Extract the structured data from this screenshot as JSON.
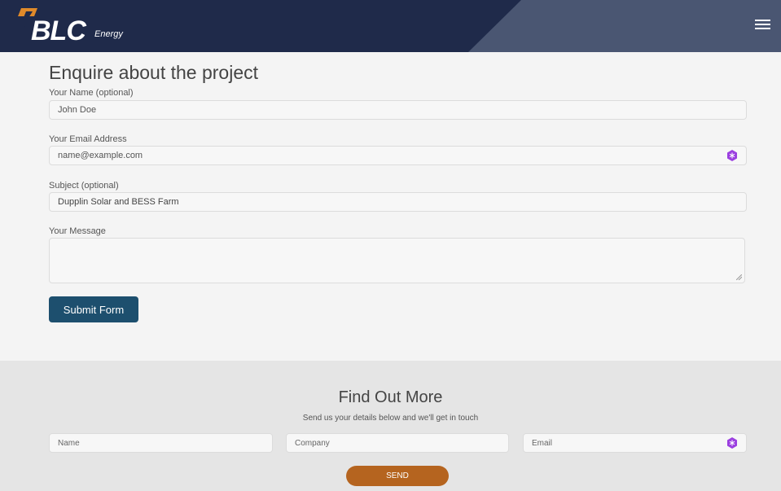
{
  "header": {
    "logo_text": "BLC",
    "logo_subtext": "Energy",
    "menu_icon": "hamburger-menu-icon",
    "brand_color": "#1f2a4a",
    "accent_color": "#e08a2a"
  },
  "form": {
    "title": "Enquire about the project",
    "name_label": "Your Name (optional)",
    "name_placeholder": "John Doe",
    "email_label": "Your Email Address",
    "email_placeholder": "name@example.com",
    "subject_label": "Subject (optional)",
    "subject_value": "Dupplin Solar and BESS Farm",
    "message_label": "Your Message",
    "message_value": "",
    "submit_label": "Submit Form",
    "submit_color": "#1d4f6e"
  },
  "footer": {
    "title": "Find Out More",
    "subtitle": "Send us your details below and we'll get in touch",
    "name_placeholder": "Name",
    "company_placeholder": "Company",
    "email_placeholder": "Email",
    "send_label": "SEND",
    "send_color": "#b5641f"
  },
  "icons": {
    "extension_icon": "password-manager-icon"
  }
}
